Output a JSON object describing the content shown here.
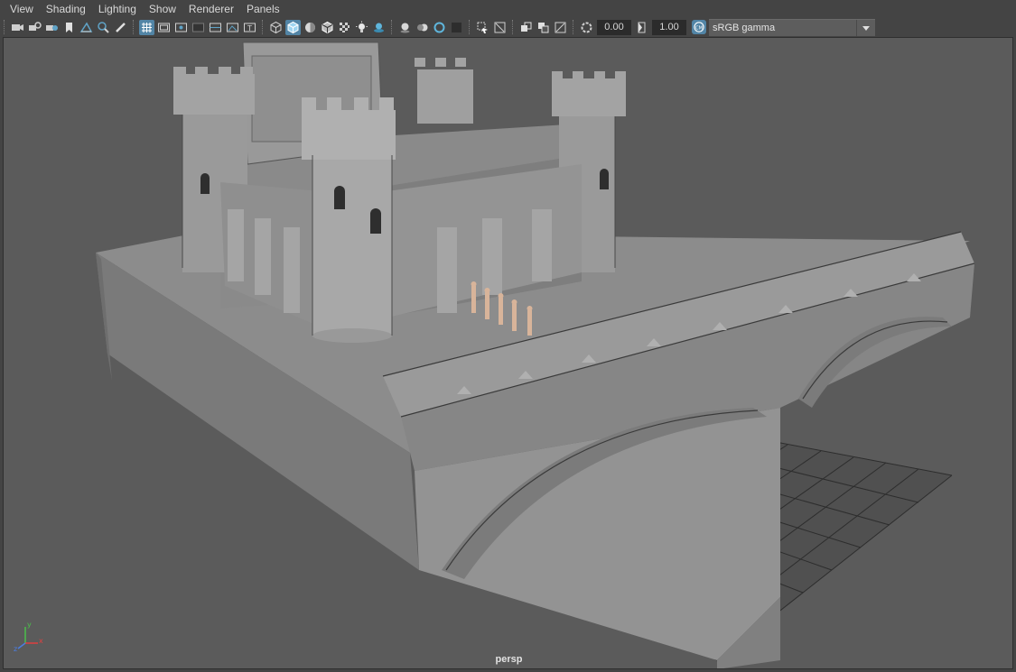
{
  "menus": [
    "View",
    "Shading",
    "Lighting",
    "Show",
    "Renderer",
    "Panels"
  ],
  "toolbar": {
    "exposure": "0.00",
    "gamma": "1.00",
    "color_space": "sRGB gamma",
    "colorspace_badge": "CM"
  },
  "viewport": {
    "camera_label": "persp",
    "axis_labels": {
      "x": "x",
      "y": "y",
      "z": "z"
    }
  },
  "colors": {
    "accent": "#5285a6",
    "background": "#5b5b5b",
    "ui_panel": "#444444"
  }
}
